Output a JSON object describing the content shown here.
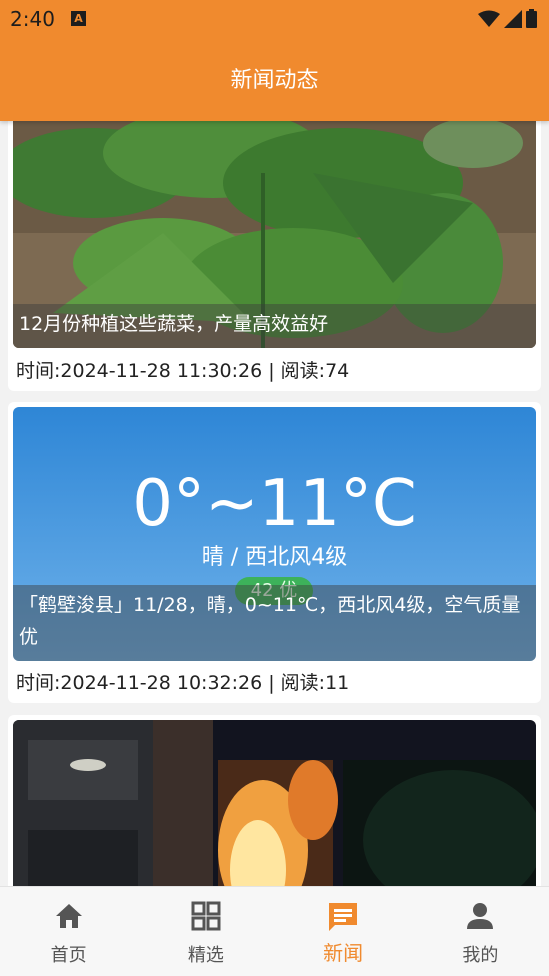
{
  "status": {
    "time": "2:40",
    "app_icon": "A"
  },
  "header": {
    "title": "新闻动态"
  },
  "news": [
    {
      "caption": "12月份种植这些蔬菜，产量高效益好",
      "meta": "时间:2024-11-28 11:30:26 | 阅读:74"
    },
    {
      "caption": "「鹤壁浚县」11/28，晴，0~11℃，西北风4级，空气质量优",
      "meta": "时间:2024-11-28 10:32:26 | 阅读:11",
      "weather": {
        "temp": "0°~11°C",
        "desc": "晴 / 西北风4级",
        "aqi": "42 优"
      }
    },
    {
      "caption": "",
      "meta": ""
    }
  ],
  "tabs": [
    {
      "label": "首页",
      "icon": "home-icon"
    },
    {
      "label": "精选",
      "icon": "grid-icon"
    },
    {
      "label": "新闻",
      "icon": "message-icon"
    },
    {
      "label": "我的",
      "icon": "person-icon"
    }
  ],
  "colors": {
    "accent": "#f08a2e"
  }
}
